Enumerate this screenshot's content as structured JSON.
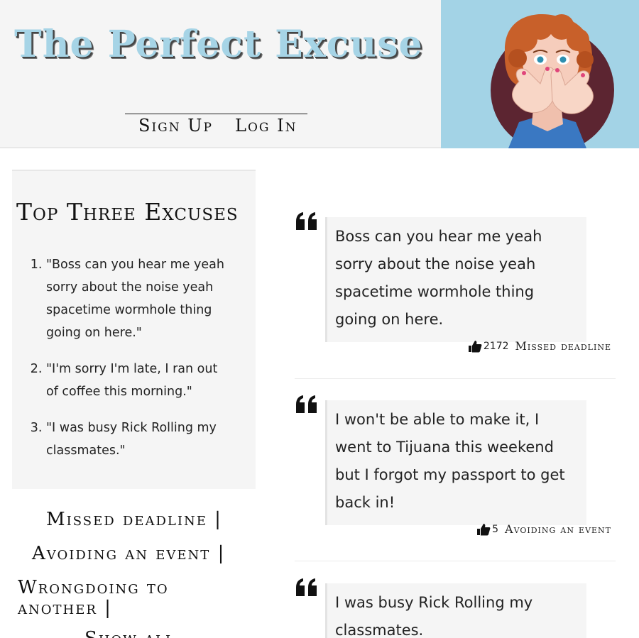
{
  "header": {
    "site_title": "The Perfect Excuse",
    "nav": {
      "signup_label": "Sign Up",
      "login_label": "Log In"
    }
  },
  "sidebar": {
    "top_title": "Top Three Excuses",
    "top_excuses": [
      "\"Boss can you hear me yeah sorry about the noise yeah spacetime wormhole thing going on here.\"",
      "\"I'm sorry I'm late, I ran out of coffee this morning.\"",
      "\"I was busy Rick Rolling my classmates.\""
    ],
    "categories": [
      "Missed deadline |",
      "Avoiding an event |",
      "Wrongdoing to",
      "another |",
      "Show all"
    ]
  },
  "excuses": [
    {
      "text": "Boss can you hear me yeah sorry about the noise yeah spacetime wormhole thing going on here.",
      "likes": "2172",
      "tag": "Missed deadline"
    },
    {
      "text": "I won't be able to make it, I went to Tijuana this weekend but I forgot my passport to get back in!",
      "likes": "5",
      "tag": "Avoiding an event"
    },
    {
      "text": "I was busy Rick Rolling my classmates.",
      "likes": "",
      "tag": ""
    }
  ],
  "colors": {
    "accent_blue": "#a6d4e6",
    "panel_gray": "#f5f5f5"
  }
}
